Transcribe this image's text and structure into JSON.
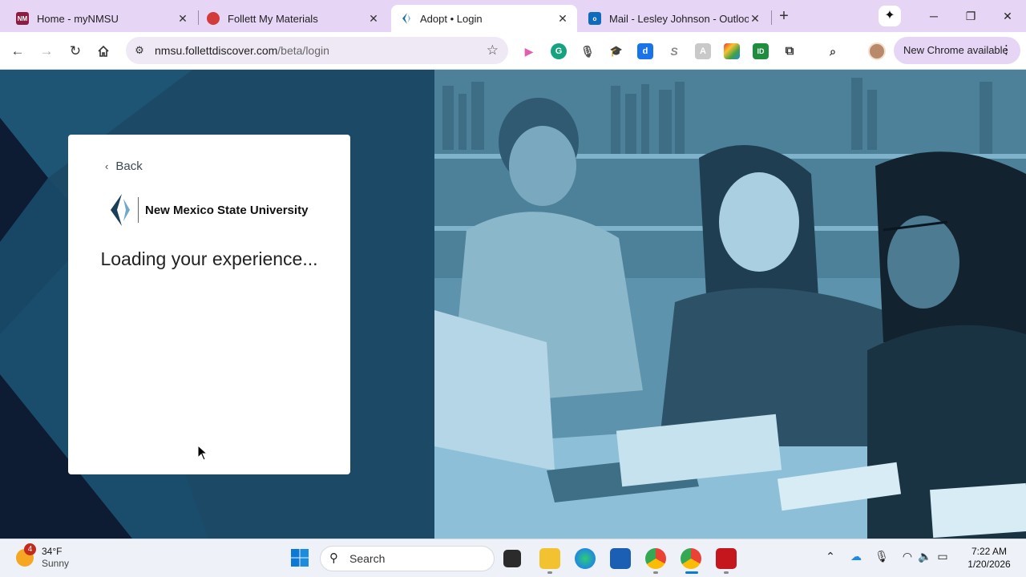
{
  "browser": {
    "tabs": [
      {
        "title": "Home - myNMSU",
        "favicon": "nmsu-favicon",
        "favicon_text": "NM",
        "active": false
      },
      {
        "title": "Follett My Materials",
        "favicon": "follett-favicon",
        "active": false
      },
      {
        "title": "Adopt • Login",
        "favicon": "adopt-favicon",
        "active": true
      },
      {
        "title": "Mail - Lesley Johnson - Outlook",
        "favicon": "outlook-favicon",
        "active": false
      }
    ],
    "new_tab_symbol": "+",
    "address": {
      "domain": "nmsu.follettdiscover.com",
      "path": "/beta/login"
    },
    "new_chrome_label": "New Chrome available",
    "extensions": [
      "pink-play-extension",
      "grammarly-extension",
      "microphone-extension",
      "hat-extension",
      "d-extension",
      "s-extension",
      "grey-extension",
      "color-grid-extension",
      "id-extension",
      "puzzle-extension"
    ]
  },
  "card": {
    "back_label": "Back",
    "university_name": "New Mexico State University",
    "loading_text": "Loading your experience..."
  },
  "taskbar": {
    "weather_temp": "34°F",
    "weather_desc": "Sunny",
    "weather_badge": "4",
    "search_placeholder": "Search",
    "time": "7:22 AM",
    "date": "1/20/2026"
  },
  "colors": {
    "tabstrip": "#e6d5f5",
    "page_bg": "#1c4a66",
    "photo_tint": "#5d93ad",
    "card": "#ffffff"
  }
}
